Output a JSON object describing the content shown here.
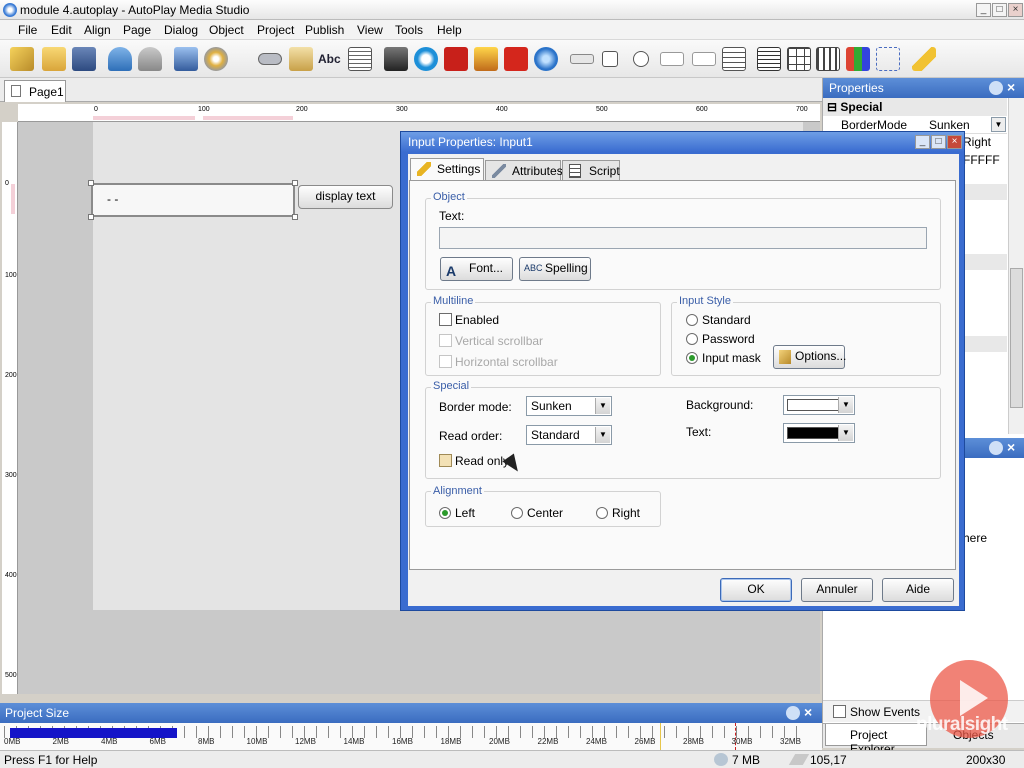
{
  "window": {
    "title": "module 4.autoplay - AutoPlay Media Studio"
  },
  "menu": [
    "File",
    "Edit",
    "Align",
    "Page",
    "Dialog",
    "Object",
    "Project",
    "Publish",
    "View",
    "Tools",
    "Help"
  ],
  "page_tab": "Page1",
  "ruler": {
    "h": [
      "0",
      "100",
      "200",
      "300",
      "400",
      "500",
      "600",
      "700"
    ],
    "v": [
      "0",
      "100",
      "200",
      "300",
      "400",
      "500"
    ]
  },
  "canvas": {
    "input_text": "-  -",
    "button_label": "display text"
  },
  "properties_panel": {
    "title": "Properties",
    "section": "Special",
    "rows": [
      {
        "name": "BorderMode",
        "value": "Sunken"
      },
      {
        "name": "",
        "value": "Right"
      },
      {
        "name": "",
        "value": "FFFFF"
      }
    ]
  },
  "explorer_panel": {
    "partial_text": "here",
    "show_events": "Show Events",
    "tabs": [
      "Project Explorer",
      "Objects"
    ]
  },
  "dialog": {
    "title": "Input Properties: Input1",
    "tabs": [
      "Settings",
      "Attributes",
      "Script"
    ],
    "object": {
      "group": "Object",
      "text_label": "Text:",
      "font_button": "Font...",
      "spelling_button": "Spelling"
    },
    "multiline": {
      "group": "Multiline",
      "enabled": "Enabled",
      "vscroll": "Vertical scrollbar",
      "hscroll": "Horizontal scrollbar"
    },
    "input_style": {
      "group": "Input Style",
      "options": [
        "Standard",
        "Password",
        "Input mask"
      ],
      "selected": "Input mask",
      "options_button": "Options..."
    },
    "special": {
      "group": "Special",
      "border_label": "Border mode:",
      "border_value": "Sunken",
      "read_order_label": "Read order:",
      "read_order_value": "Standard",
      "read_only": "Read only",
      "background_label": "Background:",
      "text_label": "Text:",
      "background_color": "#ffffff",
      "text_color": "#000000"
    },
    "alignment": {
      "group": "Alignment",
      "options": [
        "Left",
        "Center",
        "Right"
      ],
      "selected": "Left"
    },
    "buttons": {
      "ok": "OK",
      "cancel": "Annuler",
      "help": "Aide"
    }
  },
  "project_size": {
    "title": "Project Size",
    "ticks": [
      "0MB",
      "2MB",
      "4MB",
      "6MB",
      "8MB",
      "10MB",
      "12MB",
      "14MB",
      "16MB",
      "18MB",
      "20MB",
      "22MB",
      "24MB",
      "26MB",
      "28MB",
      "30MB",
      "32MB"
    ],
    "fill_fraction": 0.34
  },
  "status": {
    "help": "Press F1 for Help",
    "size": "7 MB",
    "coords": "105,17",
    "dims": "200x30"
  },
  "watermark": "pluralsight"
}
